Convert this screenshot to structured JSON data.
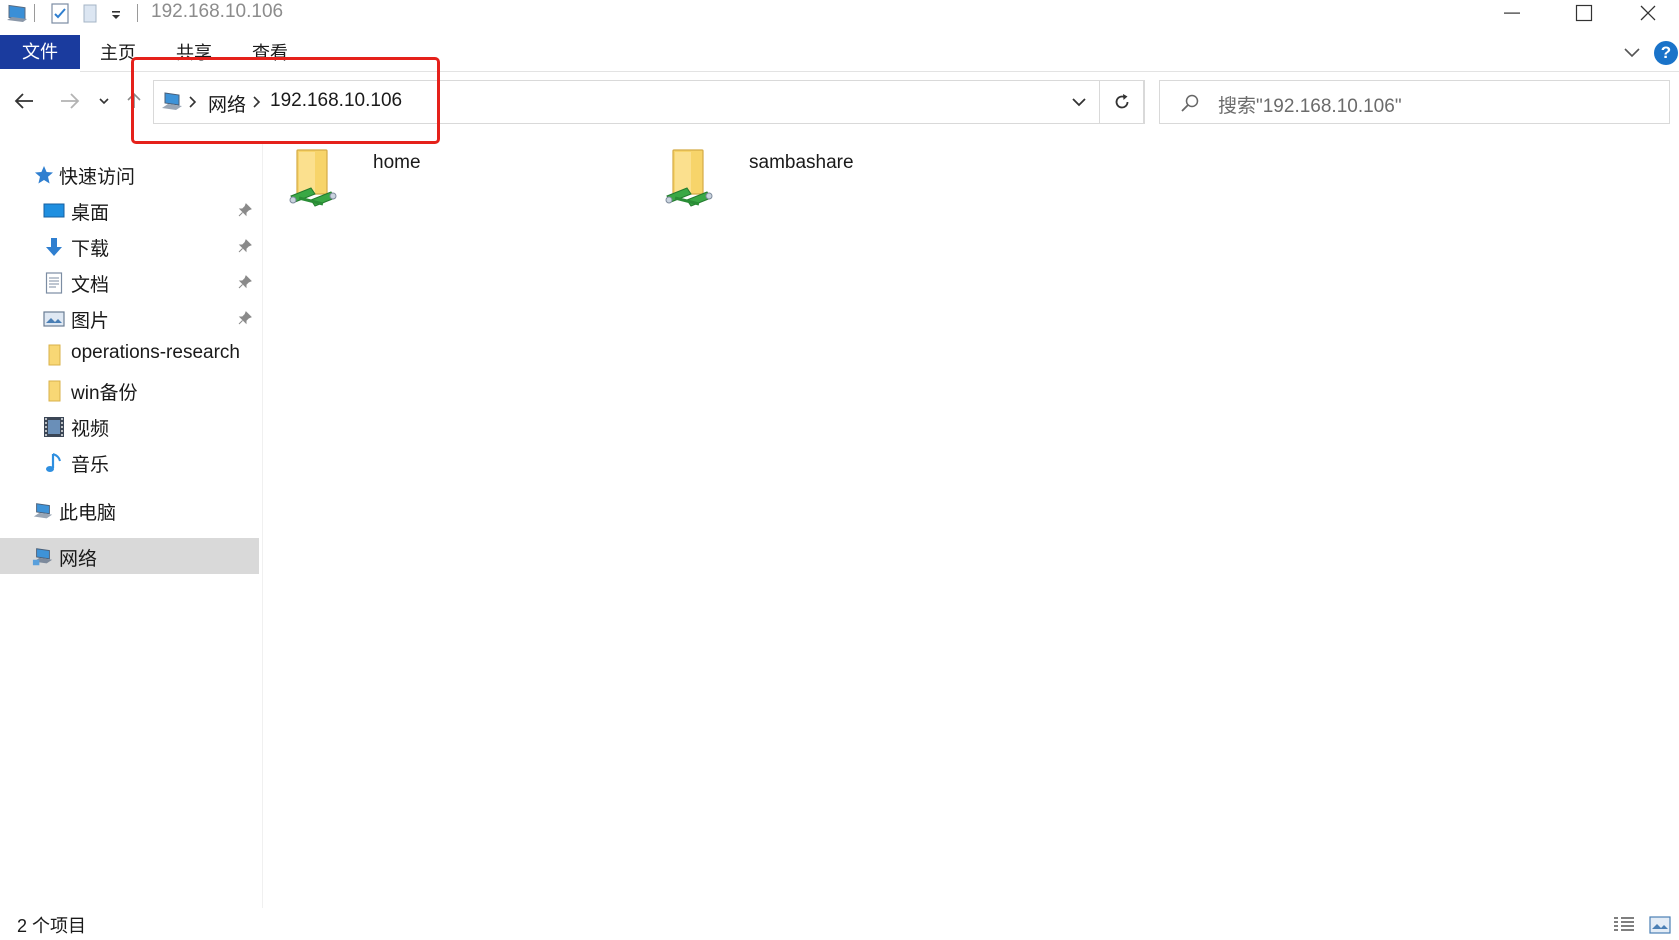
{
  "window": {
    "title": "192.168.10.106",
    "minimize_glyph": "—",
    "maximize_glyph": "☐",
    "close_glyph": "✕"
  },
  "ribbon": {
    "tabs": [
      {
        "label": "文件",
        "active": true
      },
      {
        "label": "主页"
      },
      {
        "label": "共享"
      },
      {
        "label": "查看"
      }
    ],
    "help_label": "?"
  },
  "address_bar": {
    "breadcrumbs": [
      "网络",
      "192.168.10.106"
    ]
  },
  "search": {
    "placeholder": "搜索\"192.168.10.106\""
  },
  "sidebar": {
    "quick_access": {
      "label": "快速访问",
      "icon": "star-icon"
    },
    "items": [
      {
        "label": "桌面",
        "icon": "desktop-icon",
        "pinned": true
      },
      {
        "label": "下载",
        "icon": "download-icon",
        "pinned": true
      },
      {
        "label": "文档",
        "icon": "document-icon",
        "pinned": true
      },
      {
        "label": "图片",
        "icon": "pictures-icon",
        "pinned": true
      },
      {
        "label": "operations-research",
        "icon": "folder-icon",
        "pinned": false
      },
      {
        "label": "win备份",
        "icon": "folder-icon",
        "pinned": false
      },
      {
        "label": "视频",
        "icon": "video-icon",
        "pinned": false
      },
      {
        "label": "音乐",
        "icon": "music-icon",
        "pinned": false
      }
    ],
    "this_pc": {
      "label": "此电脑",
      "icon": "computer-icon"
    },
    "network": {
      "label": "网络",
      "icon": "network-icon",
      "selected": true
    }
  },
  "content": {
    "items": [
      {
        "name": "home",
        "icon": "network-share-folder-icon"
      },
      {
        "name": "sambashare",
        "icon": "network-share-folder-icon"
      }
    ]
  },
  "status_bar": {
    "item_count": "2 个项目"
  },
  "colors": {
    "accent": "#1a3b9e",
    "highlight_box": "#e5211b",
    "selected_bg": "#d9d9d9",
    "help_blue": "#1a73c9"
  }
}
